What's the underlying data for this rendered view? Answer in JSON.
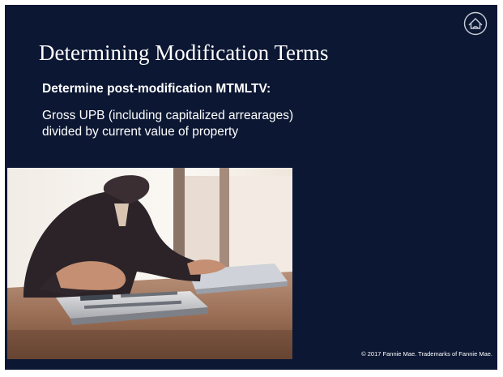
{
  "slide": {
    "title": "Determining Modification Terms",
    "subhead": "Determine post-modification MTMLTV:",
    "body_lines": [
      "Gross UPB (including capitalized arrearages)",
      "divided by current value of property"
    ],
    "footer": "© 2017 Fannie Mae. Trademarks of Fannie Mae.",
    "logo_icon": "fannie-mae-house-logo-icon",
    "photo_icon": "person-using-calculator-photo",
    "background_color": "#0c1733"
  }
}
